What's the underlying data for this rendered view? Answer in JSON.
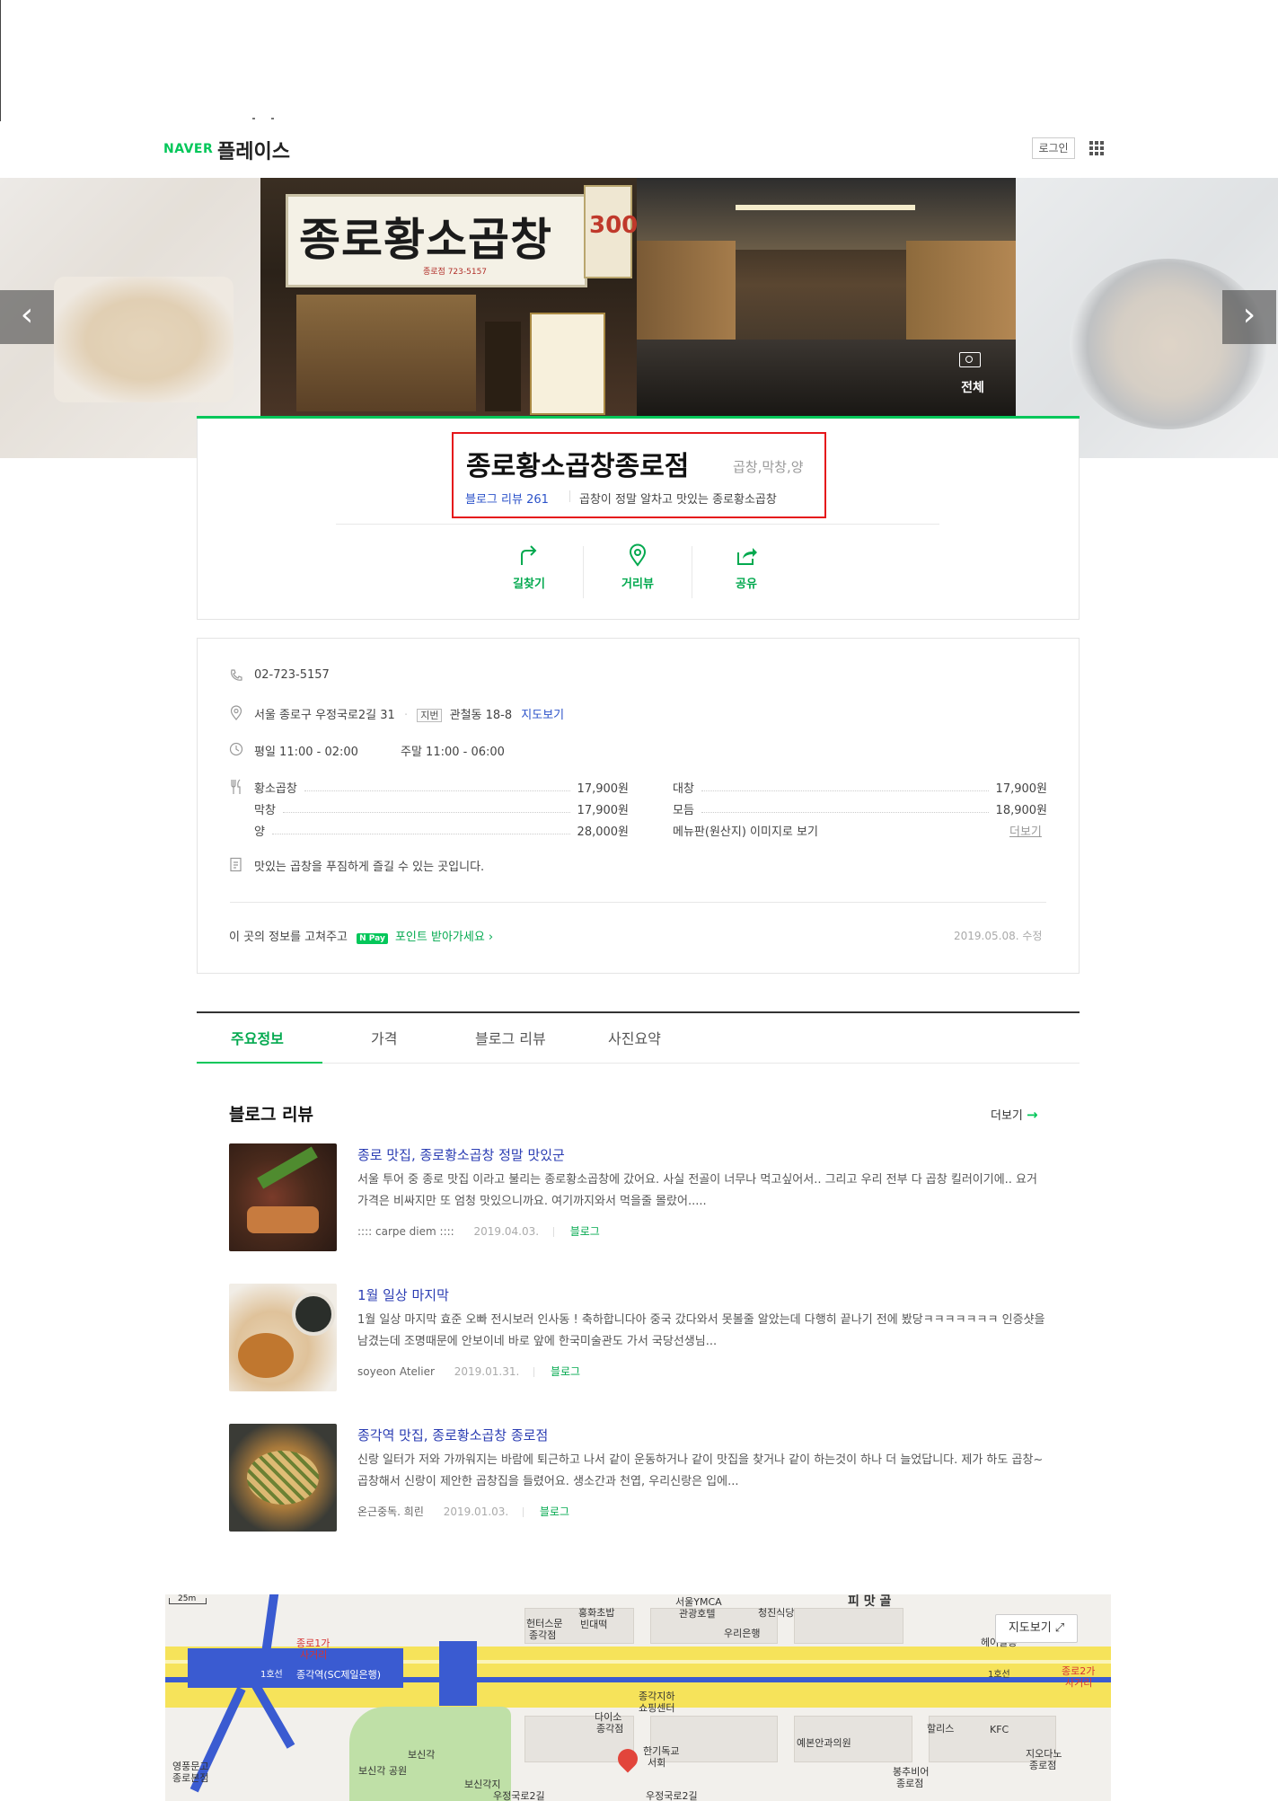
{
  "header": {
    "logo_naver": "NAVER",
    "logo_place": "플레이스",
    "login": "로그인",
    "apps_icon": "grid-icon"
  },
  "banner": {
    "sign_text": "종로황소곱창",
    "sign_sub": "종로점 723-5157",
    "side_text": "300",
    "overlay_label": "전체",
    "prev": "‹",
    "next": "›"
  },
  "place": {
    "name": "종로황소곱창종로점",
    "category": "곱창,막창,양",
    "blog_review_label": "블로그 리뷰 261",
    "summary": "곱창이 정말 알차고 맛있는 종로황소곱창",
    "actions": [
      {
        "label": "길찾기",
        "icon": "route-icon"
      },
      {
        "label": "거리뷰",
        "icon": "pin-icon"
      },
      {
        "label": "공유",
        "icon": "share-icon"
      }
    ]
  },
  "info": {
    "phone": "02-723-5157",
    "address": "서울 종로구 우정국로2길 31",
    "jibun_badge": "지번",
    "jibun": "관철동 18-8",
    "map_link": "지도보기",
    "hours_weekday": "평일 11:00 - 02:00",
    "hours_weekend": "주말 11:00 - 06:00",
    "menu": [
      {
        "name": "황소곱창",
        "price": "17,900원"
      },
      {
        "name": "막창",
        "price": "17,900원"
      },
      {
        "name": "양",
        "price": "28,000원"
      }
    ],
    "menu_right": [
      {
        "name": "대창",
        "price": "17,900원"
      },
      {
        "name": "모듬",
        "price": "18,900원"
      }
    ],
    "menu_image_link": "메뉴판(원산지) 이미지로 보기",
    "menu_more": "더보기",
    "description": "맛있는 곱창을 푸짐하게 즐길 수 있는 곳입니다.",
    "edit_prefix": "이 곳의 정보를 고쳐주고",
    "npay": "N Pay",
    "edit_link": "포인트 받아가세요 ›",
    "updated": "2019.05.08. 수정"
  },
  "tabs": [
    "주요정보",
    "가격",
    "블로그 리뷰",
    "사진요약"
  ],
  "blog": {
    "title": "블로그 리뷰",
    "more": "더보기",
    "posts": [
      {
        "title": "종로 맛집, 종로황소곱창 정말 맛있군",
        "body": "서울 투어 중 종로 맛집 이라고 불리는 종로황소곱창에 갔어요. 사실 전골이 너무나 먹고싶어서.. 그리고 우리 전부 다 곱창 킬러이기에.. 요거 가격은 비싸지만 또 엄청 맛있으니까요. 여기까지와서 먹을줄 몰랐어.....",
        "author": ":::: carpe diem ::::",
        "date": "2019.04.03.",
        "source": "블로그"
      },
      {
        "title": "1월 일상 마지막",
        "body": "1월 일상 마지막 효준 오빠 전시보러 인사동 ! 축하합니다아 중국 갔다와서 못볼줄 알았는데 다행히 끝나기 전에 봤당ㅋㅋㅋㅋㅋㅋㅋ 인증샷을 남겼는데 조명때문에 안보이네 바로 앞에 한국미술관도 가서 국당선생님...",
        "author": "soyeon Atelier",
        "date": "2019.01.31.",
        "source": "블로그"
      },
      {
        "title": "종각역 맛집, 종로황소곱창 종로점",
        "body": "신랑 일터가 저와 가까워지는 바람에 퇴근하고 나서 같이 운동하거나 같이 맛집을 찾거나 같이 하는것이 하나 더 늘었답니다. 제가 하도 곱창~곱창해서 신랑이 제안한 곱창집을 들렸어요. 생소간과 천엽, 우리신랑은 입에...",
        "author": "온근중독. 희린",
        "date": "2019.01.03.",
        "source": "블로그"
      }
    ]
  },
  "map": {
    "button": "지도보기 ⤢",
    "scale": "25m",
    "labels": [
      {
        "t": "종로1가",
        "c": "red"
      },
      {
        "t": "사거리",
        "c": "red"
      },
      {
        "t": "1호선",
        "c": "dark"
      },
      {
        "t": "종각역(SC제일은행)",
        "c": "dark"
      },
      {
        "t": "헌터스문",
        "c": "dark"
      },
      {
        "t": "종각점",
        "c": "dark"
      },
      {
        "t": "홍화초밥",
        "c": "dark"
      },
      {
        "t": "빈대떡",
        "c": "dark"
      },
      {
        "t": "서울YMCA",
        "c": "dark"
      },
      {
        "t": "관광호텔",
        "c": "dark"
      },
      {
        "t": "청진식당",
        "c": "dark"
      },
      {
        "t": "피 맛 골",
        "c": "dark"
      },
      {
        "t": "우리은행",
        "c": "dark"
      },
      {
        "t": "헤어살롱",
        "c": "dark"
      },
      {
        "t": "종로2가",
        "c": "red"
      },
      {
        "t": "사거리",
        "c": "red"
      },
      {
        "t": "종각지하",
        "c": "dark"
      },
      {
        "t": "쇼핑센터",
        "c": "dark"
      },
      {
        "t": "다이소",
        "c": "dark"
      },
      {
        "t": "종각점",
        "c": "dark"
      },
      {
        "t": "영풍문고",
        "c": "dark"
      },
      {
        "t": "종로본점",
        "c": "dark"
      },
      {
        "t": "보신각",
        "c": "dark"
      },
      {
        "t": "보신각 공원",
        "c": "dark"
      },
      {
        "t": "보신각지",
        "c": "dark"
      },
      {
        "t": "한기독교",
        "c": "dark"
      },
      {
        "t": "서회",
        "c": "dark"
      },
      {
        "t": "예본안과의원",
        "c": "dark"
      },
      {
        "t": "할리스",
        "c": "dark"
      },
      {
        "t": "KFC",
        "c": "dark"
      },
      {
        "t": "지오다노",
        "c": "dark"
      },
      {
        "t": "종로점",
        "c": "dark"
      },
      {
        "t": "봉추비어",
        "c": "dark"
      },
      {
        "t": "종로점",
        "c": "dark"
      },
      {
        "t": "우정국로2길",
        "c": "dark"
      },
      {
        "t": "우정국로2길",
        "c": "dark"
      },
      {
        "t": "1호선",
        "c": "dark"
      }
    ]
  },
  "colors": {
    "brand_green": "#03c75a",
    "link_blue": "#2b52c9",
    "highlight_red": "#e5161b",
    "subway_blue": "#3a5bd1"
  }
}
